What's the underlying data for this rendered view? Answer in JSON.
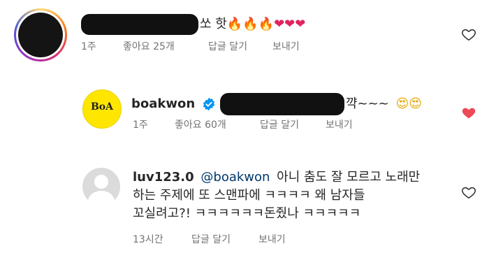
{
  "comments": [
    {
      "username_redacted": true,
      "text_suffix": "쏘 핫",
      "emoji": "🔥🔥🔥❤❤❤",
      "time": "1주",
      "likes": "좋아요 25개",
      "reply": "답글 달기",
      "send": "보내기",
      "liked": false
    },
    {
      "username": "boakwon",
      "avatar_text": "BoA",
      "text_suffix": "꺅~~~",
      "emoji": "😍😍",
      "time": "1주",
      "likes": "좋아요 60개",
      "reply": "답글 달기",
      "send": "보내기",
      "liked": true
    },
    {
      "username": "luv123.0",
      "mention": "@boakwon",
      "text_line1": "아니 춤도 잘 모르고 노래만",
      "text_line2": "하는 주제에 또 스맨파에 ㅋㅋㅋㅋ 왜 남자들",
      "text_line3": "꼬실려고?! ㅋㅋㅋㅋㅋㅋ돈줬나 ㅋㅋㅋㅋㅋ",
      "time": "13시간",
      "reply": "답글 달기",
      "send": "보내기",
      "liked": false
    }
  ],
  "colors": {
    "heart_red": "#ed4956",
    "verified_blue": "#0095f6",
    "meta_gray": "#737373",
    "mention_blue": "#00376b",
    "boa_yellow": "#ffe600"
  }
}
